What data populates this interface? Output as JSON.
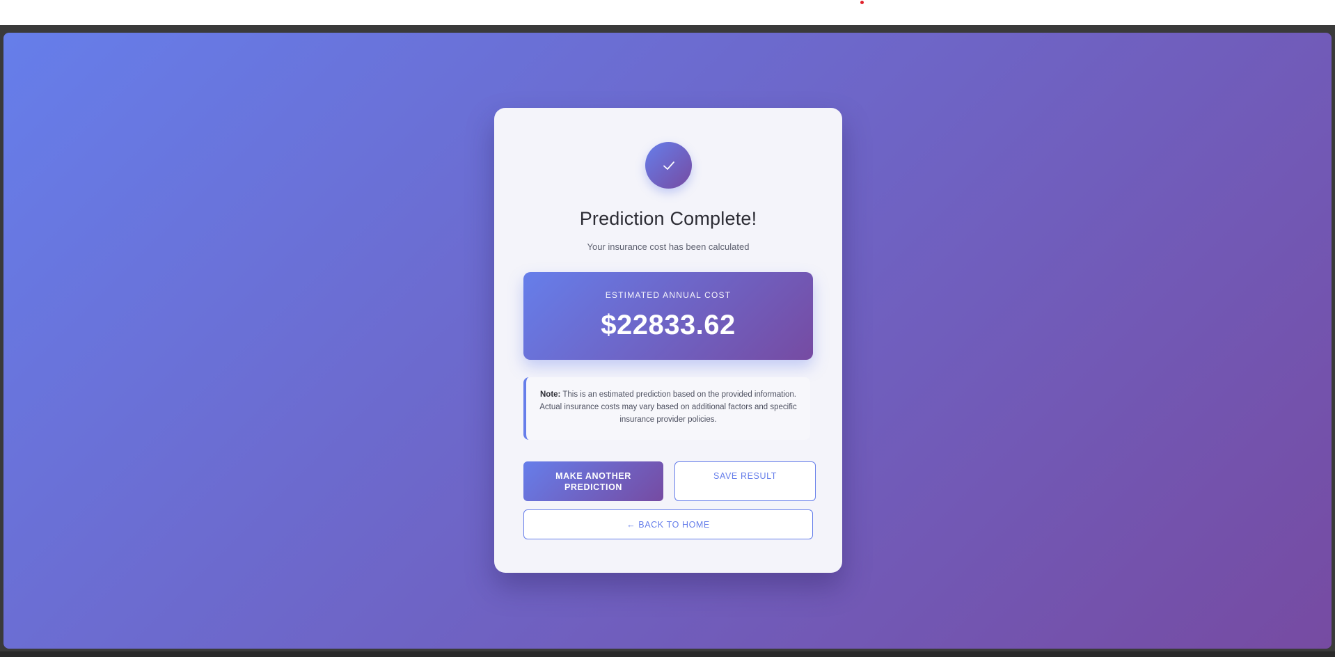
{
  "success_icon": "checkmark-icon",
  "title": "Prediction Complete!",
  "subtitle": "Your insurance cost has been calculated",
  "result": {
    "label": "ESTIMATED ANNUAL COST",
    "value": "$22833.62"
  },
  "note": {
    "label": "Note:",
    "text": "This is an estimated prediction based on the provided information. Actual insurance costs may vary based on additional factors and specific insurance provider policies."
  },
  "buttons": {
    "make_another": "MAKE ANOTHER PREDICTION",
    "save": "SAVE RESULT",
    "back_home": "← BACK TO HOME"
  },
  "colors": {
    "gradient_start": "#667eea",
    "gradient_end": "#764ba2",
    "card_background": "#f4f4fa",
    "title_text": "#2c2c34"
  }
}
